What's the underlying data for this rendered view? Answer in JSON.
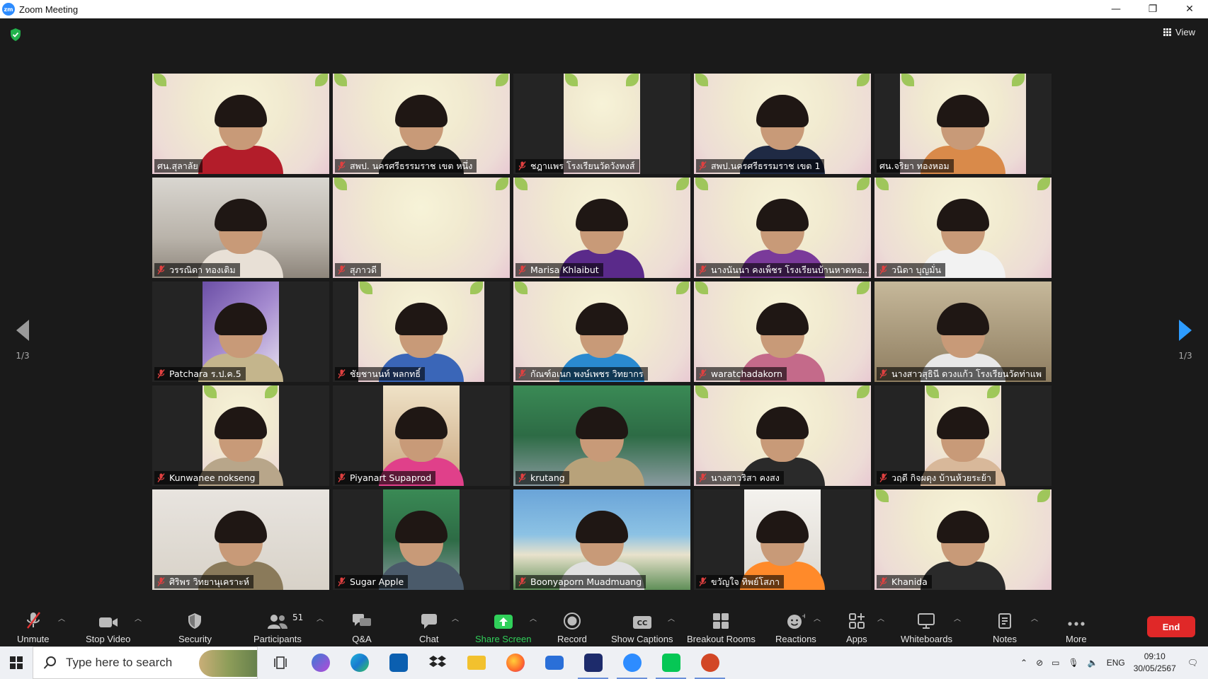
{
  "window": {
    "title": "Zoom Meeting",
    "logo": "zm",
    "controls": [
      "minimize-icon",
      "restore-icon",
      "close-icon"
    ]
  },
  "meeting": {
    "view_label": "View",
    "page_left": "1/3",
    "page_right": "1/3",
    "participants": [
      {
        "name": "ศน.สุลาลัย",
        "muted": false,
        "active": true,
        "bg": "slide",
        "shirt": "#b31d2a"
      },
      {
        "name": "สพป. นครศรีธรรมราช เขต หนึ่ง",
        "muted": true,
        "bg": "slide",
        "shirt": "#1f1f1f"
      },
      {
        "name": "ชฎาแพร โรงเรียนวัดวังหงส์",
        "muted": true,
        "bg": "slide",
        "narrow": true,
        "nobody": true
      },
      {
        "name": "สพป.นครศรีธรรมราช เขต 1",
        "muted": true,
        "bg": "slide",
        "shirt": "#1f2a44"
      },
      {
        "name": "ศน.จริยา ทองหอม",
        "muted": false,
        "bg": "slide",
        "shirt": "#d98a4a",
        "mid": true
      },
      {
        "name": "วรรณิดา ทองเติม",
        "muted": true,
        "bg": "room",
        "shirt": "#e8e0d6"
      },
      {
        "name": "สุภาวดี",
        "muted": true,
        "bg": "slide",
        "nobody": true
      },
      {
        "name": "Marisa  Khlaibut",
        "muted": true,
        "bg": "slide",
        "shirt": "#5a2a8a"
      },
      {
        "name": "นางนันนา   คงเพ็ชร โรงเรียนบ้านหาดทอ...",
        "muted": true,
        "bg": "slide",
        "shirt": "#7a3a9a"
      },
      {
        "name": "วนิดา บุญมั่น",
        "muted": true,
        "bg": "slide",
        "shirt": "#f2f2f2"
      },
      {
        "name": "Patchara ร.ป.ค.5",
        "muted": true,
        "bg": "purple",
        "narrow": true,
        "shirt": "#c4b58c"
      },
      {
        "name": "ชัยชานนท์ พลกทธิ์",
        "muted": true,
        "bg": "slide",
        "mid": true,
        "shirt": "#3a66b8"
      },
      {
        "name": "กัณฑ์อเนก พงษ์เพชร วิทยากร",
        "muted": true,
        "bg": "slide",
        "shirt": "#2a8ad0"
      },
      {
        "name": "waratchadakorn",
        "muted": true,
        "bg": "slide",
        "shirt": "#c46a8a"
      },
      {
        "name": "นางสาวสุธินี ดวงแก้ว โรงเรียนวัดท่าแพ",
        "muted": true,
        "bg": "office",
        "shirt": "#e8e8e8"
      },
      {
        "name": "Kunwanee nokseng",
        "muted": true,
        "bg": "slide",
        "narrow": true,
        "shirt": "#b8a68a"
      },
      {
        "name": "Piyanart Supaprod",
        "muted": true,
        "bg": "warm",
        "narrow": true,
        "shirt": "#e0408a"
      },
      {
        "name": "krutang",
        "muted": true,
        "bg": "green",
        "shirt": "#b8a27a"
      },
      {
        "name": "นางสาวริสา คงสง",
        "muted": true,
        "bg": "slide",
        "shirt": "#2a2a2a"
      },
      {
        "name": "วฤดี กิจผดุง บ้านห้วยระย้า",
        "muted": true,
        "bg": "slide",
        "narrow": true,
        "shirt": "#d8b89a"
      },
      {
        "name": "ศิริพร วิทยานุเคราะห์",
        "muted": true,
        "bg": "cream",
        "shirt": "#8a7a5a"
      },
      {
        "name": "Sugar Apple",
        "muted": true,
        "bg": "green",
        "narrow": true,
        "shirt": "#4a5a6a"
      },
      {
        "name": "Boonyaporn Muadmuang",
        "muted": true,
        "bg": "beach",
        "shirt": "#e0e0e0"
      },
      {
        "name": "ขวัญใจ ทิพย์โสภา",
        "muted": true,
        "bg": "white",
        "narrow": true,
        "shirt": "#ff8a2a"
      },
      {
        "name": "Khanida",
        "muted": true,
        "bg": "slide",
        "shirt": "#2a2a2a"
      }
    ]
  },
  "toolbar": {
    "unmute": "Unmute",
    "stop_video": "Stop Video",
    "security": "Security",
    "participants": "Participants",
    "participants_count": "51",
    "qa": "Q&A",
    "chat": "Chat",
    "share_screen": "Share Screen",
    "record": "Record",
    "show_captions": "Show Captions",
    "breakout_rooms": "Breakout Rooms",
    "reactions": "Reactions",
    "apps": "Apps",
    "whiteboards": "Whiteboards",
    "notes": "Notes",
    "more": "More",
    "end": "End",
    "share_color": "#30d05a",
    "end_color": "#e02828"
  },
  "taskbar": {
    "search_placeholder": "Type here to search",
    "language": "ENG",
    "time": "09:10",
    "date": "30/05/2567"
  }
}
